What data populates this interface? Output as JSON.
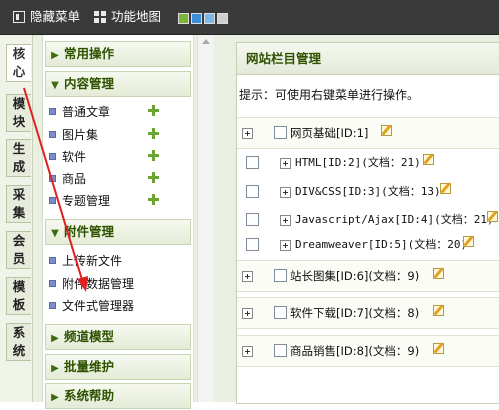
{
  "topbar": {
    "items": [
      {
        "label": "隐藏菜单",
        "icon": "hide-menu-icon"
      },
      {
        "label": "功能地图",
        "icon": "function-map-icon"
      }
    ],
    "skin_colors": [
      "#7db53a",
      "#3a8fd8",
      "#7fb7e8",
      "#cfcfcf"
    ]
  },
  "vtabs": [
    {
      "label": "核心",
      "active": true
    },
    {
      "label": "模块"
    },
    {
      "label": "生成"
    },
    {
      "label": "采集"
    },
    {
      "label": "会员"
    },
    {
      "label": "模板"
    },
    {
      "label": "系统"
    }
  ],
  "menu": {
    "common_ops": "常用操作",
    "content_mgmt": "内容管理",
    "content_items": [
      {
        "label": "普通文章",
        "has_add": true
      },
      {
        "label": "图片集",
        "has_add": true
      },
      {
        "label": "软件",
        "has_add": true
      },
      {
        "label": "商品",
        "has_add": true
      },
      {
        "label": "专题管理",
        "has_add": true
      }
    ],
    "attachment_mgmt": "附件管理",
    "attachment_items": [
      {
        "label": "上传新文件"
      },
      {
        "label": "附件数据管理"
      },
      {
        "label": "文件式管理器"
      }
    ],
    "channel_model": "频道模型",
    "batch_maint": "批量维护",
    "system_help": "系统帮助"
  },
  "main": {
    "title": "网站栏目管理",
    "tip": "提示：可使用右键菜单进行操作。",
    "rows": [
      {
        "text": "网页基础[ID:1]",
        "level": 0
      },
      {
        "text": "HTML[ID:2](文档：21)",
        "level": 1
      },
      {
        "text": "DIV&CSS[ID:3](文档：13)",
        "level": 1
      },
      {
        "text": "Javascript/Ajax[ID:4](文档：21)",
        "level": 1
      },
      {
        "text": "Dreamweaver[ID:5](文档：20)",
        "level": 1
      },
      {
        "text": "站长图集[ID:6](文档：9)",
        "level": 0
      },
      {
        "text": "软件下载[ID:7](文档：8)",
        "level": 0
      },
      {
        "text": "商品销售[ID:8](文档：9)",
        "level": 0
      }
    ]
  },
  "annotation": {
    "color": "#e02020"
  }
}
